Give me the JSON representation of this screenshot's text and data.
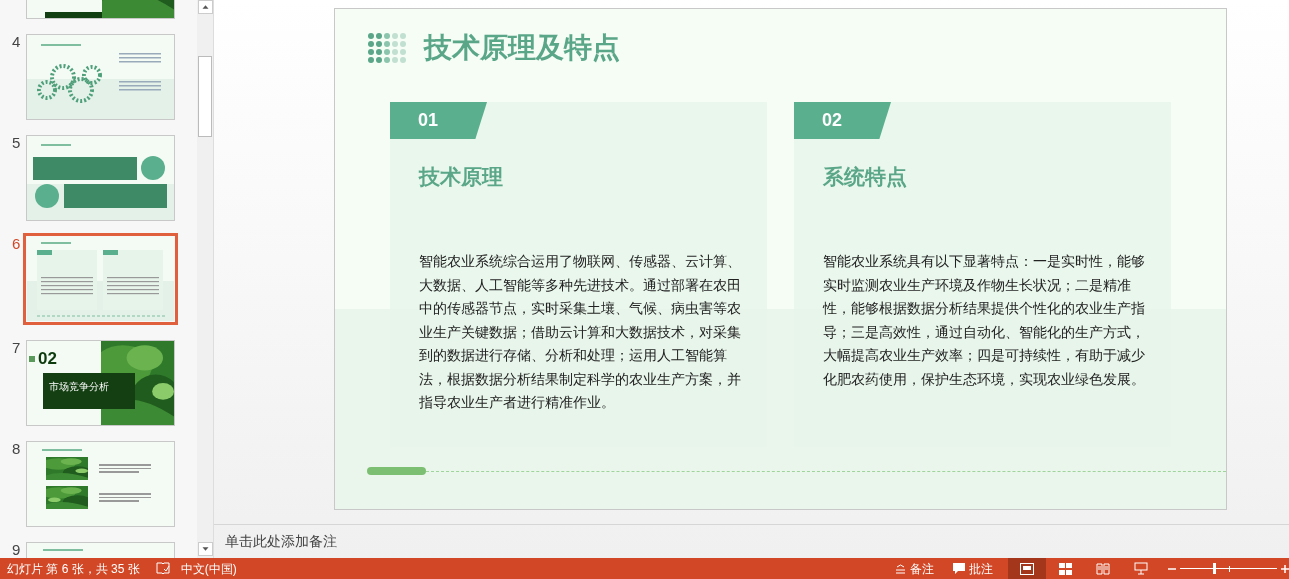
{
  "thumbnails": [
    {
      "kind": "section-cut",
      "selected": false
    },
    {
      "number": "4",
      "kind": "gears",
      "selected": false
    },
    {
      "number": "5",
      "kind": "banners",
      "selected": false
    },
    {
      "number": "6",
      "kind": "columns",
      "selected": true
    },
    {
      "number": "7",
      "kind": "section",
      "selected": false,
      "big_number": "02",
      "title": "市场竞争分析"
    },
    {
      "number": "8",
      "kind": "photos",
      "selected": false
    },
    {
      "number": "9",
      "kind": "blank-cut",
      "selected": false
    }
  ],
  "slide": {
    "title": "技术原理及特点",
    "cards": [
      {
        "number": "01",
        "heading": "技术原理",
        "body": "智能农业系统综合运用了物联网、传感器、云计算、大数据、人工智能等多种先进技术。通过部署在农田中的传感器节点，实时采集土壤、气候、病虫害等农业生产关键数据；借助云计算和大数据技术，对采集到的数据进行存储、分析和处理；运用人工智能算法，根据数据分析结果制定科学的农业生产方案，并指导农业生产者进行精准作业。"
      },
      {
        "number": "02",
        "heading": "系统特点",
        "body": "智能农业系统具有以下显著特点：一是实时性，能够实时监测农业生产环境及作物生长状况；二是精准性，能够根据数据分析结果提供个性化的农业生产指导；三是高效性，通过自动化、智能化的生产方式，大幅提高农业生产效率；四是可持续性，有助于减少化肥农药使用，保护生态环境，实现农业绿色发展。"
      }
    ]
  },
  "notes": {
    "placeholder": "单击此处添加备注"
  },
  "status_bar": {
    "slide_info": "幻灯片 第 6 张，共 35 张",
    "language": "中文(中国)",
    "notes": "备注",
    "comments": "批注",
    "views": [
      {
        "kind": "normal",
        "selected": true
      },
      {
        "kind": "sorter",
        "selected": false
      },
      {
        "kind": "reading",
        "selected": false
      },
      {
        "kind": "slideshow",
        "selected": false
      }
    ],
    "zoom": {
      "level": 0.35
    }
  }
}
